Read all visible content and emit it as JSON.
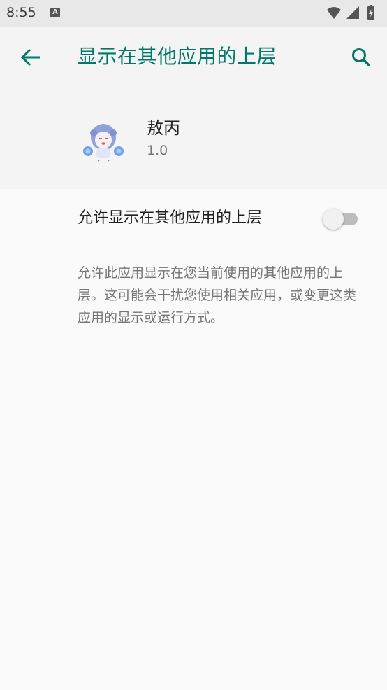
{
  "status_bar": {
    "time": "8:55",
    "notification_icon": "a-notification-icon",
    "right_icons": [
      "wifi-icon",
      "signal-icon",
      "battery-charging-icon"
    ]
  },
  "toolbar": {
    "title": "显示在其他应用的上层",
    "back_icon": "arrow-back-icon",
    "search_icon": "search-icon",
    "accent_color": "#00796b"
  },
  "app": {
    "name": "敖丙",
    "version": "1.0",
    "icon": "app-icon"
  },
  "permission": {
    "label": "允许显示在其他应用的上层",
    "enabled": false
  },
  "description": "允许此应用显示在您当前使用的其他应用的上层。这可能会干扰您使用相关应用，或变更这类应用的显示或运行方式。"
}
